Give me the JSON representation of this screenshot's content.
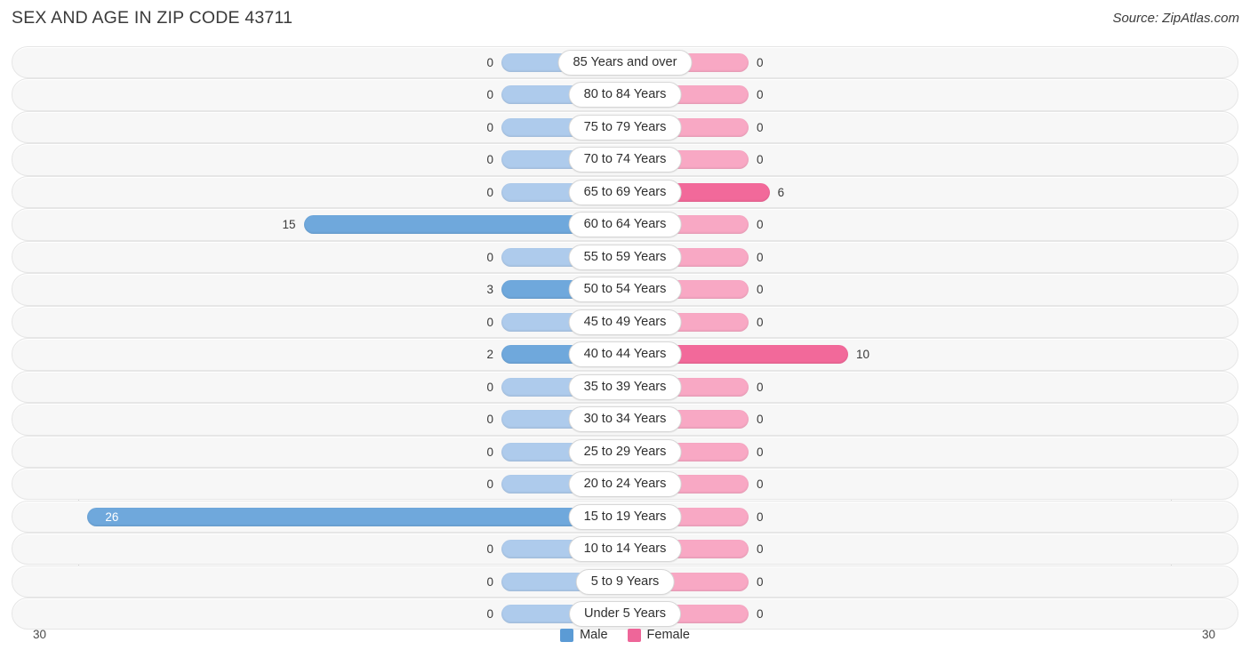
{
  "header": {
    "title": "SEX AND AGE IN ZIP CODE 43711",
    "source": "Source: ZipAtlas.com"
  },
  "legend": {
    "male_label": "Male",
    "female_label": "Female",
    "male_color": "#5b9bd5",
    "female_color": "#ee6699"
  },
  "axis": {
    "left_max": "30",
    "right_max": "30"
  },
  "colors": {
    "male_active": "#6fa8dc",
    "male_zero": "#aecbec",
    "female_active": "#f2699a",
    "female_zero": "#f8a8c4",
    "track": "#f7f7f7",
    "track_border": "#e6e6e6"
  },
  "chart_data": {
    "type": "bar",
    "subtype": "population-pyramid",
    "title": "SEX AND AGE IN ZIP CODE 43711",
    "xlabel": "",
    "ylabel": "",
    "xlim": [
      30,
      30
    ],
    "grid": false,
    "legend_position": "bottom-center",
    "categories": [
      "85 Years and over",
      "80 to 84 Years",
      "75 to 79 Years",
      "70 to 74 Years",
      "65 to 69 Years",
      "60 to 64 Years",
      "55 to 59 Years",
      "50 to 54 Years",
      "45 to 49 Years",
      "40 to 44 Years",
      "35 to 39 Years",
      "30 to 34 Years",
      "25 to 29 Years",
      "20 to 24 Years",
      "15 to 19 Years",
      "10 to 14 Years",
      "5 to 9 Years",
      "Under 5 Years"
    ],
    "series": [
      {
        "name": "Male",
        "color": "#5b9bd5",
        "values": [
          0,
          0,
          0,
          0,
          0,
          15,
          0,
          3,
          0,
          2,
          0,
          0,
          0,
          0,
          26,
          0,
          0,
          0
        ]
      },
      {
        "name": "Female",
        "color": "#ee6699",
        "values": [
          0,
          0,
          0,
          0,
          6,
          0,
          0,
          0,
          0,
          10,
          0,
          0,
          0,
          0,
          0,
          0,
          0,
          0
        ]
      }
    ],
    "rows": [
      {
        "age": "85 Years and over",
        "male": 0,
        "female": 0,
        "male_text": "0",
        "female_text": "0"
      },
      {
        "age": "80 to 84 Years",
        "male": 0,
        "female": 0,
        "male_text": "0",
        "female_text": "0"
      },
      {
        "age": "75 to 79 Years",
        "male": 0,
        "female": 0,
        "male_text": "0",
        "female_text": "0"
      },
      {
        "age": "70 to 74 Years",
        "male": 0,
        "female": 0,
        "male_text": "0",
        "female_text": "0"
      },
      {
        "age": "65 to 69 Years",
        "male": 0,
        "female": 6,
        "male_text": "0",
        "female_text": "6"
      },
      {
        "age": "60 to 64 Years",
        "male": 15,
        "female": 0,
        "male_text": "15",
        "female_text": "0"
      },
      {
        "age": "55 to 59 Years",
        "male": 0,
        "female": 0,
        "male_text": "0",
        "female_text": "0"
      },
      {
        "age": "50 to 54 Years",
        "male": 3,
        "female": 0,
        "male_text": "3",
        "female_text": "0"
      },
      {
        "age": "45 to 49 Years",
        "male": 0,
        "female": 0,
        "male_text": "0",
        "female_text": "0"
      },
      {
        "age": "40 to 44 Years",
        "male": 2,
        "female": 10,
        "male_text": "2",
        "female_text": "10"
      },
      {
        "age": "35 to 39 Years",
        "male": 0,
        "female": 0,
        "male_text": "0",
        "female_text": "0"
      },
      {
        "age": "30 to 34 Years",
        "male": 0,
        "female": 0,
        "male_text": "0",
        "female_text": "0"
      },
      {
        "age": "25 to 29 Years",
        "male": 0,
        "female": 0,
        "male_text": "0",
        "female_text": "0"
      },
      {
        "age": "20 to 24 Years",
        "male": 0,
        "female": 0,
        "male_text": "0",
        "female_text": "0"
      },
      {
        "age": "15 to 19 Years",
        "male": 26,
        "female": 0,
        "male_text": "26",
        "female_text": "0"
      },
      {
        "age": "10 to 14 Years",
        "male": 0,
        "female": 0,
        "male_text": "0",
        "female_text": "0"
      },
      {
        "age": "5 to 9 Years",
        "male": 0,
        "female": 0,
        "male_text": "0",
        "female_text": "0"
      },
      {
        "age": "Under 5 Years",
        "male": 0,
        "female": 0,
        "male_text": "0",
        "female_text": "0"
      }
    ]
  }
}
